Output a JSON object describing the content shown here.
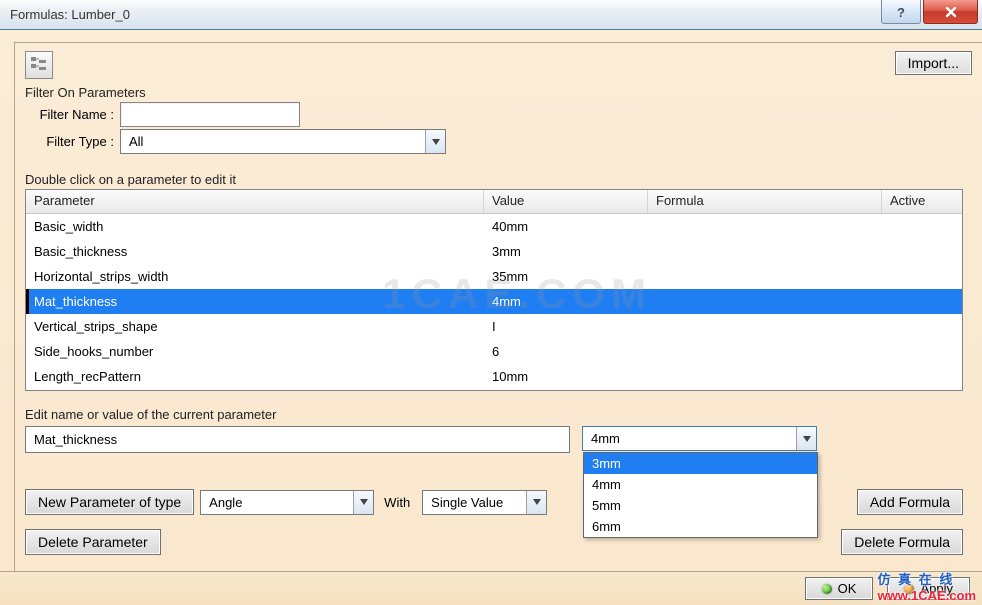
{
  "window": {
    "title": "Formulas: Lumber_0"
  },
  "top": {
    "import_label": "Import...",
    "filter_section": "Filter On Parameters",
    "filter_name_label": "Filter Name :",
    "filter_name_value": "",
    "filter_type_label": "Filter Type :",
    "filter_type_value": "All"
  },
  "table": {
    "hint": "Double click on a parameter to edit it",
    "headers": {
      "param": "Parameter",
      "val": "Value",
      "form": "Formula",
      "act": "Active"
    },
    "rows": [
      {
        "param": "Basic_width",
        "val": "40mm",
        "sel": false
      },
      {
        "param": "Basic_thickness",
        "val": "3mm",
        "sel": false
      },
      {
        "param": "Horizontal_strips_width",
        "val": "35mm",
        "sel": false
      },
      {
        "param": "Mat_thickness",
        "val": "4mm",
        "sel": true
      },
      {
        "param": "Vertical_strips_shape",
        "val": "I",
        "sel": false
      },
      {
        "param": "Side_hooks_number",
        "val": "6",
        "sel": false
      },
      {
        "param": "Length_recPattern",
        "val": "10mm",
        "sel": false
      }
    ],
    "watermark": "1CAE.COM"
  },
  "edit": {
    "label": "Edit name or value of the current parameter",
    "name_value": "Mat_thickness",
    "value_pick": "4mm",
    "options": [
      {
        "label": "3mm",
        "hover": true
      },
      {
        "label": "4mm",
        "hover": false
      },
      {
        "label": "5mm",
        "hover": false
      },
      {
        "label": "6mm",
        "hover": false
      }
    ]
  },
  "actions": {
    "new_param": "New Parameter of type",
    "param_type_value": "Angle",
    "with_label": "With",
    "with_value": "Single Value",
    "add_formula": "Add Formula",
    "delete_param": "Delete Parameter",
    "delete_formula": "Delete Formula"
  },
  "bottom": {
    "ok": "OK",
    "apply": "Apply"
  },
  "branding": {
    "cn": "仿 真 在 线",
    "url": "www.1CAE.com"
  }
}
